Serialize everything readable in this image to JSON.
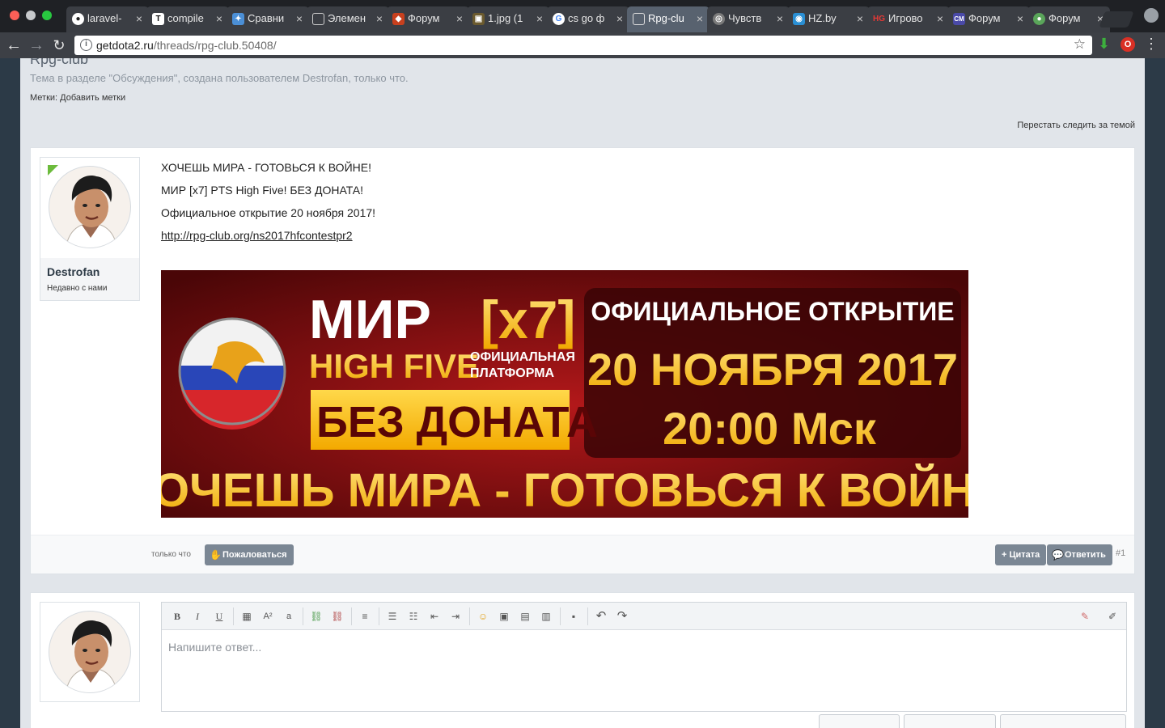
{
  "browser": {
    "tabs": [
      {
        "title": "laravel-",
        "favicon": "github-icon",
        "active": false
      },
      {
        "title": "compile",
        "favicon": "T",
        "active": false
      },
      {
        "title": "Сравни",
        "favicon": "puzzle-icon",
        "active": false
      },
      {
        "title": "Элемен",
        "favicon": "document-icon",
        "active": false
      },
      {
        "title": "Форум",
        "favicon": "forum-icon",
        "active": false
      },
      {
        "title": "1.jpg (1",
        "favicon": "image-icon",
        "active": false
      },
      {
        "title": "cs go ф",
        "favicon": "google-icon",
        "active": false
      },
      {
        "title": "Rpg-clu",
        "favicon": "document-icon",
        "active": true
      },
      {
        "title": "Чувств",
        "favicon": "globe-icon",
        "active": false
      },
      {
        "title": "HZ.by",
        "favicon": "hz-icon",
        "active": false
      },
      {
        "title": "Игрово",
        "favicon": "HG",
        "active": false
      },
      {
        "title": "Форум",
        "favicon": "CM",
        "active": false
      },
      {
        "title": "Форум",
        "favicon": "flag-icon",
        "active": false
      }
    ],
    "url_domain": "getdota2.ru",
    "url_path": "/threads/rpg-club.50408/"
  },
  "thread": {
    "title": "Rpg-club",
    "description": "Тема в разделе \"Обсуждения\", создана пользователем Destrofan, только что.",
    "tags_label": "Метки:",
    "tags_action": "Добавить метки",
    "unwatch_link": "Перестать следить за темой"
  },
  "post": {
    "username": "Destrofan",
    "user_title": "Недавно с нами",
    "lines": [
      "ХОЧЕШЬ МИРА - ГОТОВЬСЯ К ВОЙНЕ!",
      "МИР [x7] PTS High Five! БЕЗ ДОНАТА!",
      "Официальное открытие 20 ноября 2017!"
    ],
    "link": "http://rpg-club.org/ns2017hfcontestpr2",
    "banner": {
      "brand_word": "МИР",
      "brand_rate": "[x7]",
      "chronicle": "HIGH FIVE",
      "platform_line1": "ОФИЦИАЛЬНАЯ",
      "platform_line2": "ПЛАТФОРМА",
      "no_donate": "БЕЗ ДОНАТА",
      "opening": "ОФИЦИАЛЬНОЕ ОТКРЫТИЕ",
      "date": "20 НОЯБРЯ 2017",
      "time": "20:00 Мск",
      "slogan": "ХОЧЕШЬ МИРА - ГОТОВЬСЯ К ВОЙНЕ"
    },
    "time": "только что",
    "report_label": "Пожаловаться",
    "quote_label": "+ Цитата",
    "reply_label": "Ответить",
    "number": "#1"
  },
  "reply": {
    "placeholder": "Напишите ответ..."
  },
  "colors": {
    "tab_bar": "#1f2125",
    "active_tab": "#58626f",
    "page_bg": "#e1e5ea",
    "button_grey": "#7b8794",
    "banner_red": "#7e0b0d",
    "banner_gold": "#f5b800",
    "online": "#6cbb3c"
  }
}
